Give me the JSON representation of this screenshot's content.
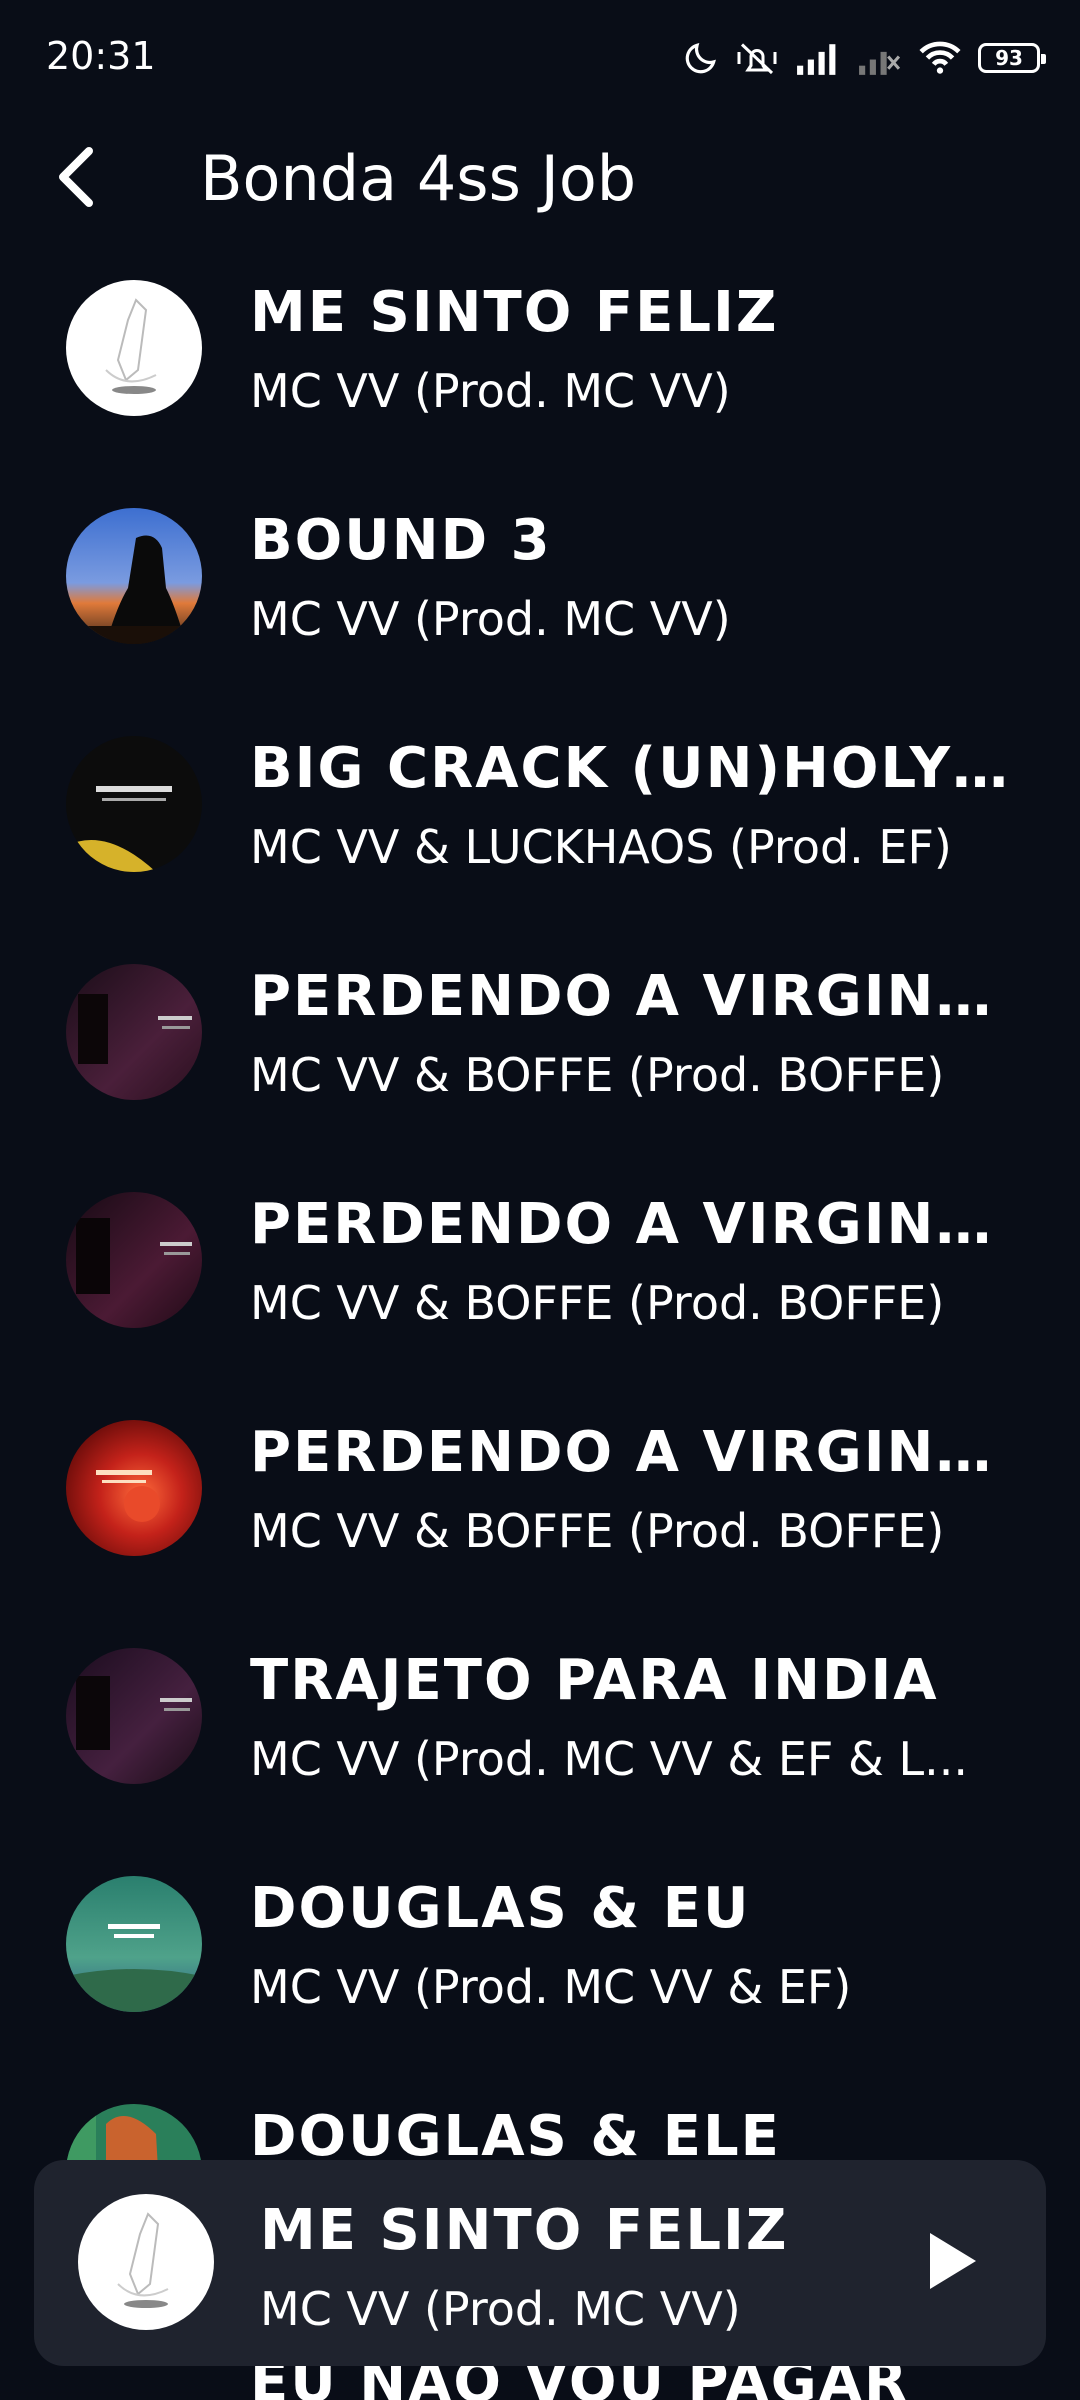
{
  "status_bar": {
    "time": "20:31",
    "battery": "93",
    "icons": [
      "moon-icon",
      "mute-vibrate-icon",
      "signal-icon",
      "signal-off-icon",
      "wifi-icon",
      "battery-icon"
    ]
  },
  "header": {
    "back_icon": "chevron-left-icon",
    "title": "Bonda 4ss Job"
  },
  "tracks": [
    {
      "title": "ME SINTO FELIZ",
      "artist": "MC VV (Prod. MC VV)",
      "cover": "white-sketch"
    },
    {
      "title": "BOUND 3",
      "artist": "MC VV (Prod. MC VV)",
      "cover": "sunset-silhouette"
    },
    {
      "title": "BIG CRACK (UN)HOLY R...",
      "artist": "MC VV & LUCKHAOS (Prod. EF)",
      "cover": "dark-yellow"
    },
    {
      "title": "PERDENDO A VIRGINDA...",
      "artist": "MC VV & BOFFE (Prod. BOFFE)",
      "cover": "dark-purple"
    },
    {
      "title": "PERDENDO A VIRGINDA...",
      "artist": "MC VV & BOFFE (Prod. BOFFE)",
      "cover": "dark-purple"
    },
    {
      "title": "PERDENDO A VIRGINDA...",
      "artist": "MC VV & BOFFE (Prod. BOFFE)",
      "cover": "red"
    },
    {
      "title": "TRAJETO PARA INDIA",
      "artist": "MC VV (Prod. MC VV & EF & L...",
      "cover": "dark-purple"
    },
    {
      "title": "DOUGLAS & EU",
      "artist": "MC VV (Prod. MC VV & EF)",
      "cover": "teal"
    },
    {
      "title": "DOUGLAS & ELE",
      "artist": "",
      "cover": "green-orange"
    }
  ],
  "mini_player": {
    "title": "ME SINTO FELIZ",
    "artist": "MC VV (Prod. MC VV)",
    "play_icon": "play-icon"
  },
  "peek_text": "EU NAO VOU PAGAR",
  "colors": {
    "background": "#090d17",
    "mini_player_bg": "#1f232e",
    "text": "#ffffff"
  }
}
